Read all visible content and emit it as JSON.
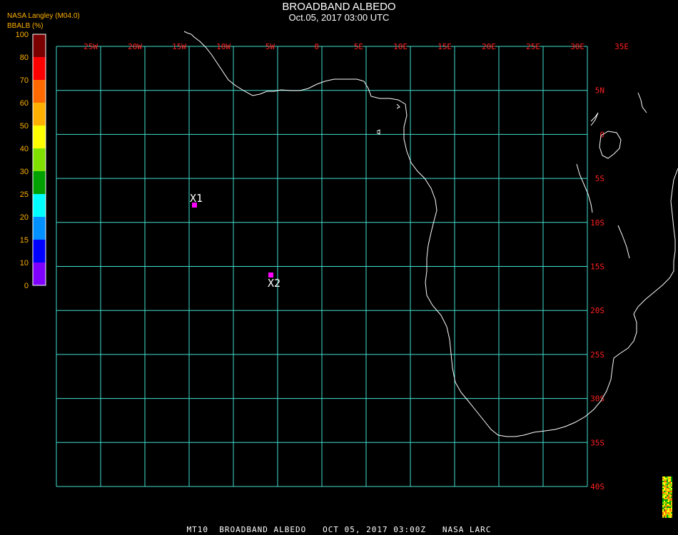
{
  "header": {
    "title": "BROADBAND ALBEDO",
    "subtitle": "Oct.05, 2017 03:00 UTC",
    "source": "NASA Langley (M04.0)",
    "unit_label": "BBALB (%)"
  },
  "legend": {
    "tick_labels": [
      "100",
      "80",
      "70",
      "60",
      "50",
      "40",
      "30",
      "25",
      "20",
      "15",
      "10",
      "0"
    ],
    "colors": [
      "#7a0000",
      "#ff0000",
      "#ff6a00",
      "#ffb000",
      "#ffff00",
      "#80e000",
      "#00a000",
      "#00ffff",
      "#0090ff",
      "#0000ff",
      "#8000ff"
    ]
  },
  "map": {
    "lon_labels": [
      "25W",
      "20W",
      "15W",
      "10W",
      "5W",
      "0",
      "5E",
      "10E",
      "15E",
      "20E",
      "25E",
      "30E",
      "35E"
    ],
    "lat_labels": [
      "5N",
      "0",
      "5S",
      "10S",
      "15S",
      "20S",
      "25S",
      "30S",
      "35S",
      "40S"
    ],
    "grid_color": "#40e0d0",
    "label_color": "#ff2020",
    "coast_color": "#ffffff",
    "markers": [
      {
        "label": "X1",
        "color": "#ff00ff"
      },
      {
        "label": "X2",
        "color": "#ff00ff"
      }
    ]
  },
  "footer": {
    "text": "MT10  BROADBAND ALBEDO   OCT 05, 2017 03:00Z   NASA LARC"
  }
}
